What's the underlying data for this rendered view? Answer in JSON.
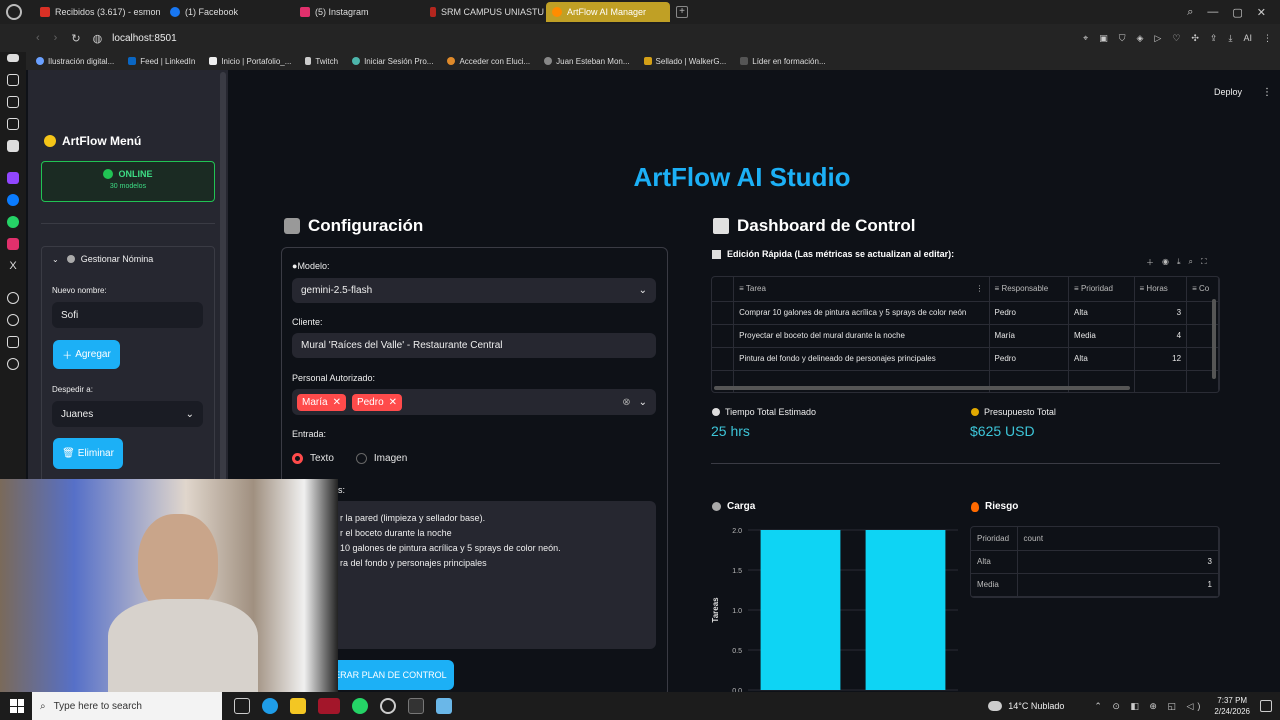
{
  "browser": {
    "tabs": [
      {
        "label": "Recibidos (3.617) - esmon",
        "color": "#d93025"
      },
      {
        "label": "(1) Facebook",
        "color": "#1877f2"
      },
      {
        "label": "(5) Instagram",
        "color": "#e1306c"
      },
      {
        "label": "SRM CAMPUS UNIASTUR",
        "color": "#b3261e"
      },
      {
        "label": "ArtFlow AI Manager",
        "color": "#ff8c00"
      }
    ],
    "url": "localhost:8501",
    "bookmarks": [
      "Ilustración digital...",
      "Feed | LinkedIn",
      "Inicio | Portafolio_...",
      "Twitch",
      "Iniciar Sesión Pro...",
      "Acceder con Eluci...",
      "Juan Esteban Mon...",
      "Sellado | WalkerG...",
      "Líder en formación..."
    ],
    "ai_label": "AI"
  },
  "sidebar": {
    "title": "ArtFlow Menú",
    "status": "ONLINE",
    "models": "30 modelos",
    "expander": "Gestionar Nómina",
    "new_name_label": "Nuevo nombre:",
    "new_name_value": "Sofi",
    "add_button": "Agregar",
    "dismiss_label": "Despedir a:",
    "dismiss_value": "Juanes",
    "delete_button": "Eliminar"
  },
  "main": {
    "deploy": "Deploy",
    "title": "ArtFlow AI Studio",
    "config_header": "Configuración",
    "model_label": "Modelo:",
    "model_value": "gemini-2.5-flash",
    "client_label": "Cliente:",
    "client_value": "Mural 'Raíces del Valle' - Restaurante Central",
    "staff_label": "Personal Autorizado:",
    "staff": [
      "María",
      "Pedro"
    ],
    "input_label": "Entrada:",
    "radio_text": "Texto",
    "radio_image": "Imagen",
    "notes_label_partial": "es:",
    "notes_lines": [
      "r la pared (limpieza y sellador base).",
      "r el boceto durante la noche",
      "10 galones de pintura acrílica y 5 sprays de color neón.",
      "ra del fondo y personajes principales"
    ],
    "generate_button": "GENERAR PLAN DE CONTROL",
    "dashboard_header": "Dashboard de Control",
    "quick_edit": "Edición Rápida (Las métricas se actualizan al editar):",
    "task_columns": [
      "Tarea",
      "Responsable",
      "Prioridad",
      "Horas",
      "Co"
    ],
    "tasks": [
      {
        "tarea": "Comprar 10 galones de pintura acrílica y 5 sprays de color neón",
        "responsable": "Pedro",
        "prioridad": "Alta",
        "horas": "3"
      },
      {
        "tarea": "Proyectar el boceto del mural durante la noche",
        "responsable": "María",
        "prioridad": "Media",
        "horas": "4"
      },
      {
        "tarea": "Pintura del fondo y delineado de personajes principales",
        "responsable": "Pedro",
        "prioridad": "Alta",
        "horas": "12"
      }
    ],
    "time_label": "Tiempo Total Estimado",
    "time_value": "25 hrs",
    "budget_label": "Presupuesto Total",
    "budget_value": "$625 USD",
    "load_header": "Carga",
    "risk_header": "Riesgo",
    "risk_columns": [
      "Prioridad",
      "count"
    ],
    "risk_rows": [
      {
        "prioridad": "Alta",
        "count": "3"
      },
      {
        "prioridad": "Media",
        "count": "1"
      }
    ]
  },
  "chart_data": {
    "type": "bar",
    "categories": [
      "",
      ""
    ],
    "values": [
      2,
      2
    ],
    "ylabel": "Tareas",
    "ylim": [
      0,
      2
    ],
    "yticks": [
      "0.0",
      "0.5",
      "1.0",
      "1.5",
      "2.0"
    ],
    "bar_color": "#0ed4f4"
  },
  "taskbar": {
    "search_placeholder": "Type here to search",
    "weather": "14°C  Nublado",
    "time": "7:37 PM",
    "date": "2/24/2026"
  }
}
